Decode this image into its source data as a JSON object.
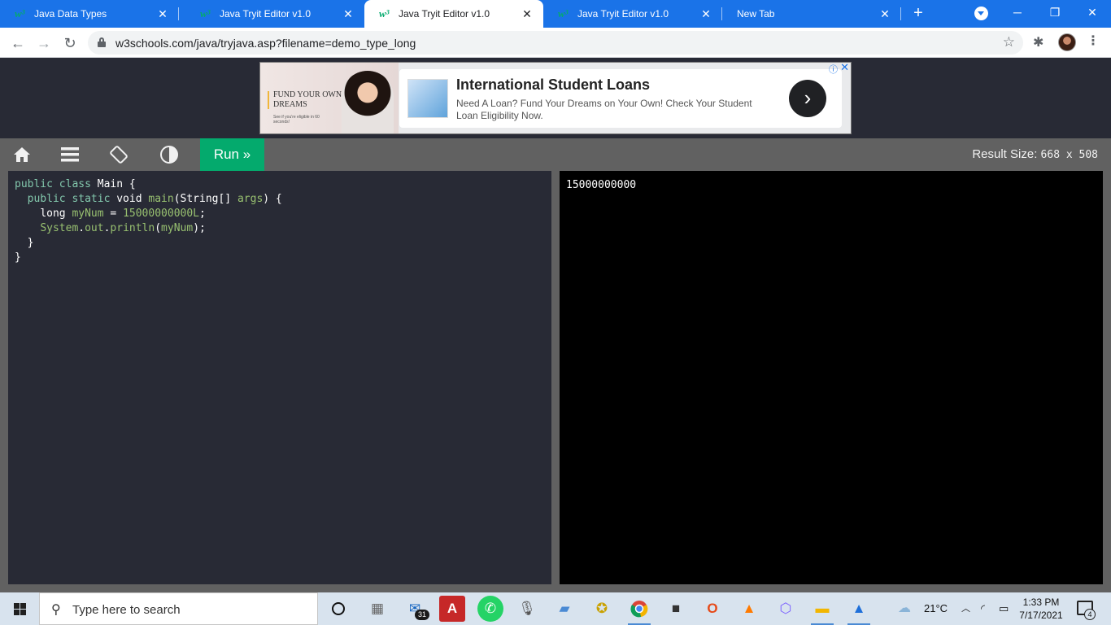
{
  "browser": {
    "tabs": [
      {
        "title": "Java Data Types",
        "active": false
      },
      {
        "title": "Java Tryit Editor v1.0",
        "active": false
      },
      {
        "title": "Java Tryit Editor v1.0",
        "active": true
      },
      {
        "title": "Java Tryit Editor v1.0",
        "active": false
      },
      {
        "title": "New Tab",
        "active": false
      }
    ],
    "url": "w3schools.com/java/tryjava.asp?filename=demo_type_long",
    "accent_color": "#1a73e8"
  },
  "ad": {
    "left_headline": "FUND YOUR OWN DREAMS",
    "left_small": "See if you're eligible in 60 seconds!",
    "title": "International Student Loans",
    "description": "Need A Loan? Fund Your Dreams on Your Own! Check Your Student Loan Eligibility Now.",
    "info_icon": "ⓘ",
    "close_icon": "✕"
  },
  "toolbar": {
    "run_label": "Run »",
    "result_size_label": "Result Size:",
    "result_size_value": "668 x 508",
    "run_color": "#04aa6d"
  },
  "editor": {
    "lines": [
      "public class Main {",
      "  public static void main(String[] args) {",
      "    long myNum = 15000000000L;",
      "    System.out.println(myNum);",
      "  }",
      "}"
    ],
    "line1": {
      "kw": "public class",
      "name": "Main",
      "rest": " {"
    },
    "line2": {
      "indent": "  ",
      "kw": "public static",
      "type": " void ",
      "fn": "main",
      "a": "(String[] ",
      "arg": "args",
      "b": ") {"
    },
    "line3": {
      "indent": "    ",
      "type": "long ",
      "var": "myNum",
      "eq": " = ",
      "num": "15000000000L",
      "end": ";"
    },
    "line4": {
      "indent": "    ",
      "obj": "System",
      "dot1": ".",
      "out": "out",
      "dot2": ".",
      "fn": "println",
      "a": "(",
      "var": "myNum",
      "b": ");"
    },
    "line5": "  }",
    "line6": "}"
  },
  "result": {
    "output": "15000000000"
  },
  "taskbar": {
    "search_placeholder": "Type here to search",
    "mail_badge": "31",
    "weather": "21°C",
    "time": "1:33 PM",
    "date": "7/17/2021",
    "notification_count": "4"
  }
}
